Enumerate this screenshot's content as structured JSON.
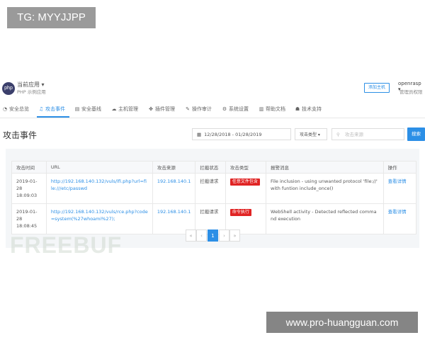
{
  "watermarks": {
    "top": "TG: MYYJJPP",
    "bottom": "www.pro-huangguan.com",
    "freebuf": "FREEBUF"
  },
  "header": {
    "logo": "php",
    "app_name": "当前应用 ▾",
    "app_sub": "PHP 示例应用",
    "add_button": "添加主机",
    "user": "openrasp ▾",
    "user_sub": "管理员权限"
  },
  "nav": {
    "items": [
      {
        "label": "安全总览",
        "icon": "dashboard-icon",
        "glyph": "◔"
      },
      {
        "label": "攻击事件",
        "icon": "bell-icon",
        "glyph": "♫"
      },
      {
        "label": "安全基线",
        "icon": "baseline-icon",
        "glyph": "▤"
      },
      {
        "label": "主机管理",
        "icon": "cloud-icon",
        "glyph": "☁"
      },
      {
        "label": "插件管理",
        "icon": "plugin-icon",
        "glyph": "✤"
      },
      {
        "label": "操作审计",
        "icon": "audit-icon",
        "glyph": "✎"
      },
      {
        "label": "系统设置",
        "icon": "gear-icon",
        "glyph": "⚙"
      },
      {
        "label": "帮助文档",
        "icon": "book-icon",
        "glyph": "▥"
      },
      {
        "label": "技术支持",
        "icon": "support-icon",
        "glyph": "☗"
      }
    ],
    "active_index": 1
  },
  "main": {
    "title": "攻击事件",
    "date_range": "12/28/2018 - 01/28/2019",
    "type_filter": "攻击类型 ▾",
    "search_placeholder": "攻击来源",
    "search_button": "搜索"
  },
  "table": {
    "headers": [
      "攻击时间",
      "URL",
      "攻击来源",
      "拦截状态",
      "攻击类型",
      "报警消息",
      "操作"
    ],
    "rows": [
      {
        "time": "2019-01-28 18:09:03",
        "url": "http://192.168.140.132/vuls/lfi.php?url=file:///etc/passwd",
        "source": "192.168.140.1",
        "status": "拦截请求",
        "type": "任意文件包含",
        "message": "File inclusion - using unwanted protocol 'file://' with funtion include_once()",
        "action": "查看详情"
      },
      {
        "time": "2019-01-28 18:08:45",
        "url": "http://192.168.140.132/vuls/rce.php?code=system(%27whoami%27);",
        "source": "192.168.140.1",
        "status": "拦截请求",
        "type": "命令执行",
        "message": "WebShell activity - Detected reflected command execution",
        "action": "查看详情"
      }
    ]
  },
  "pagination": {
    "prev": "«",
    "prev2": "‹",
    "current": "1",
    "next2": "›",
    "next": "»"
  },
  "colors": {
    "accent": "#2c8fe6",
    "danger": "#e02424"
  }
}
